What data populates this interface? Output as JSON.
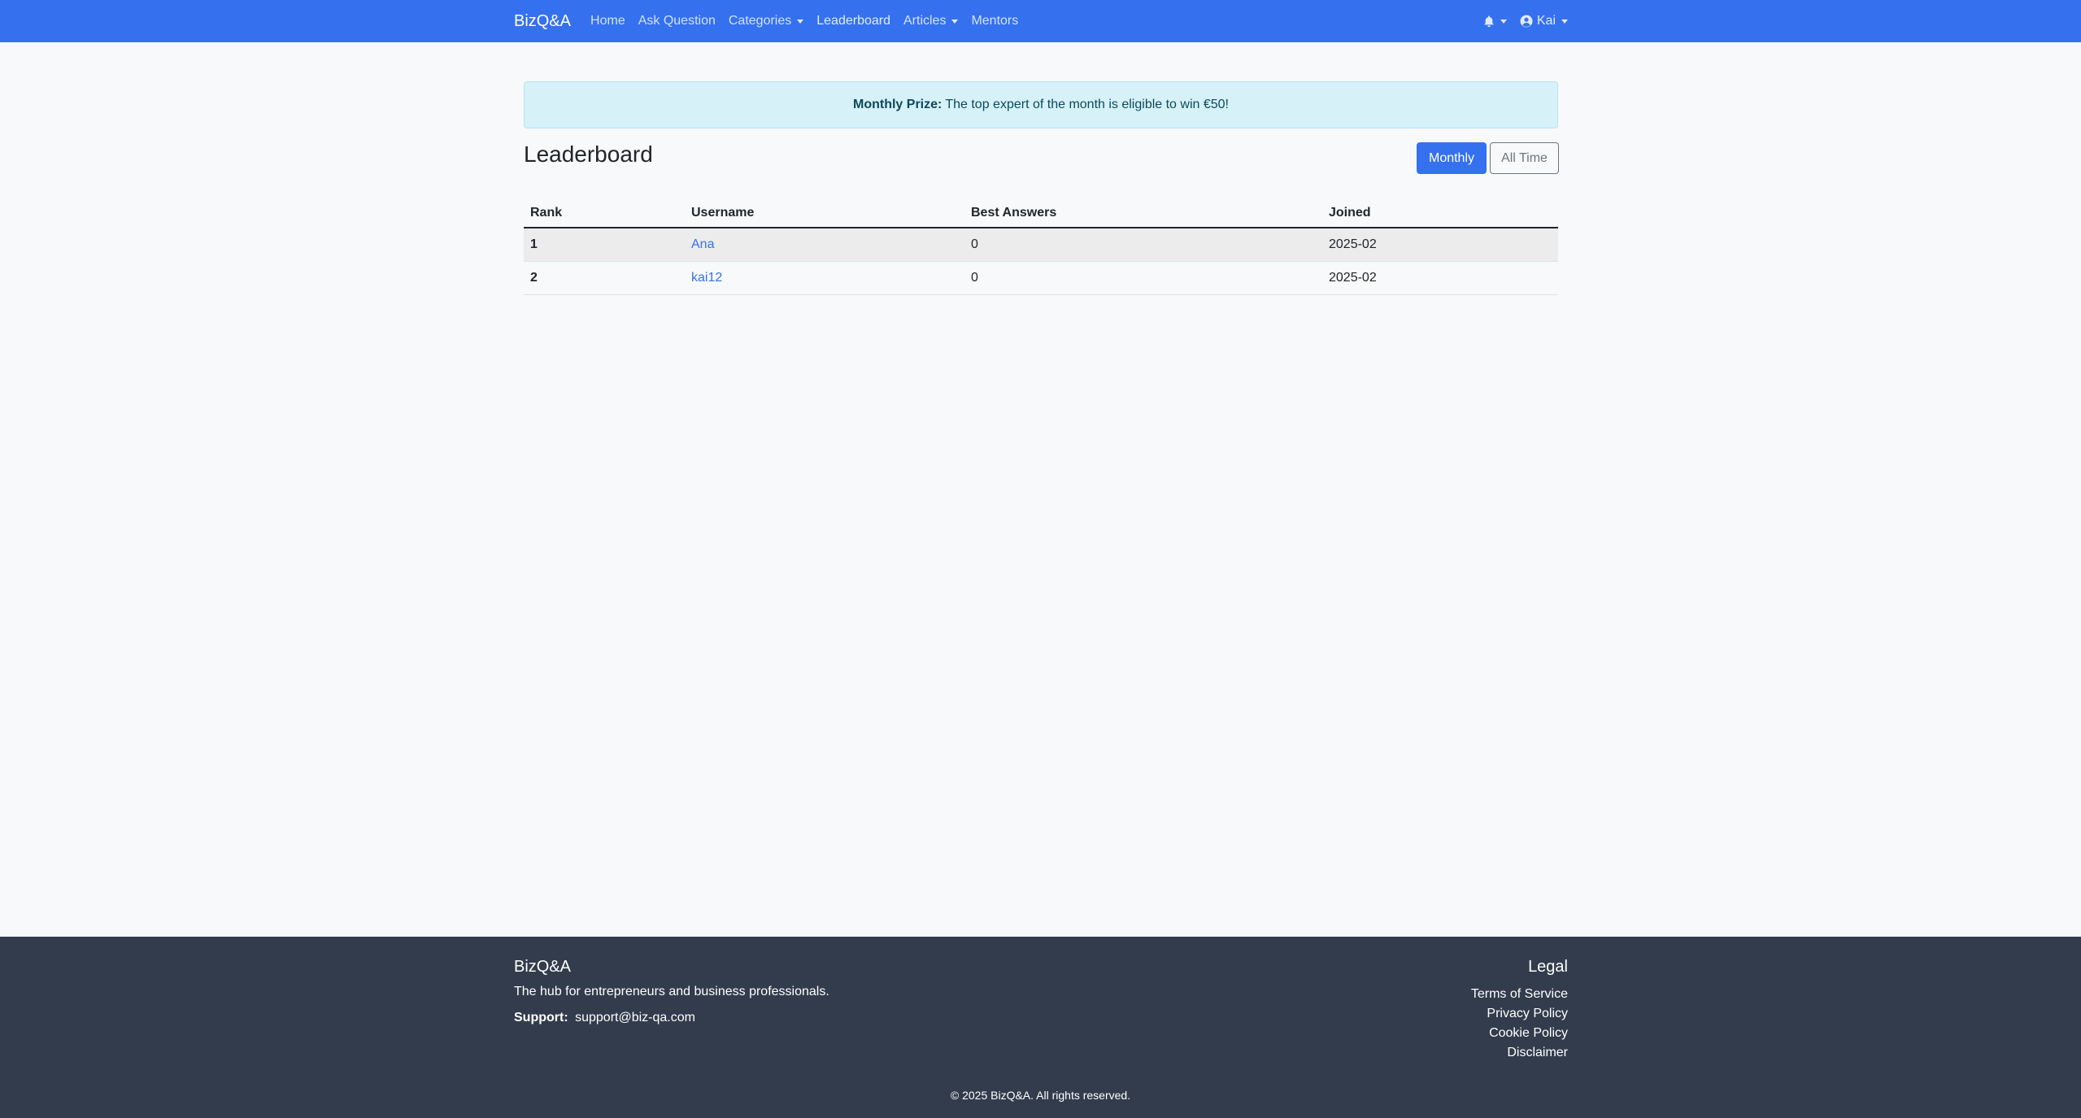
{
  "navbar": {
    "brand": "BizQ&A",
    "links": [
      "Home",
      "Ask Question",
      "Categories",
      "Leaderboard",
      "Articles",
      "Mentors"
    ],
    "user_name": "Kai",
    "icons": {
      "notifications": "bell-icon",
      "user": "user-circle-icon"
    }
  },
  "alert": {
    "label": "Monthly Prize:",
    "text": "The top expert of the month is eligible to win €50!"
  },
  "leaderboard": {
    "title": "Leaderboard",
    "buttons": {
      "monthly": "Monthly",
      "all_time": "All Time"
    },
    "columns": [
      "Rank",
      "Username",
      "Best Answers",
      "Joined"
    ],
    "rows": [
      {
        "rank": "1",
        "username": "Ana",
        "best_answers": "0",
        "joined": "2025-02"
      },
      {
        "rank": "2",
        "username": "kai12",
        "best_answers": "0",
        "joined": "2025-02"
      }
    ]
  },
  "footer": {
    "brand": "BizQ&A",
    "tagline": "The hub for entrepreneurs and business professionals.",
    "support_label": "Support:",
    "support_email": "support@biz-qa.com",
    "legal_title": "Legal",
    "legal_links": [
      "Terms of Service",
      "Privacy Policy",
      "Cookie Policy",
      "Disclaimer"
    ],
    "copyright": "© 2025 BizQ&A. All rights reserved."
  },
  "colors": {
    "primary": "#3571ee",
    "alert_bg": "#d7f1f9",
    "footer_bg": "#323c4c"
  }
}
